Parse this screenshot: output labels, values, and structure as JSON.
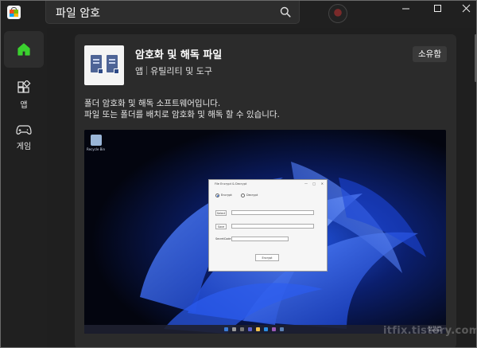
{
  "search": {
    "query": "파일 암호"
  },
  "nav": {
    "home_label": "",
    "apps_label": "앱",
    "games_label": "게임"
  },
  "app": {
    "title": "암호화 및 해독 파일",
    "category_type": "앱",
    "category": "유틸리티 및 도구",
    "owned_button": "소유함",
    "description_line1": "폴더 암호화 및 해독 소프트웨어입니다.",
    "description_line2": "파일 또는 폴더를 배치로 암호화 및 해독 할 수 있습니다."
  },
  "screenshot": {
    "recycle_bin": "Recycle Bin",
    "dialog_title": "File Encrypt & Decrypt",
    "radio_encrypt": "Encrypt",
    "radio_decrypt": "Decrypt",
    "select_button": "Select",
    "save_button": "Save",
    "secret_code_label": "SecretCode",
    "action_button": "Encrypt",
    "clock_time": "11:59 AM",
    "clock_date": "6/4/2022"
  },
  "watermark": "itfix.tistory.com",
  "colors": {
    "home_accent": "#3bd12f",
    "window_bg": "#202020",
    "card_bg": "#2b2b2b"
  },
  "icons": [
    "store-logo-icon",
    "search-icon",
    "minimize-icon",
    "maximize-icon",
    "close-icon",
    "home-icon",
    "apps-icon",
    "games-icon"
  ]
}
